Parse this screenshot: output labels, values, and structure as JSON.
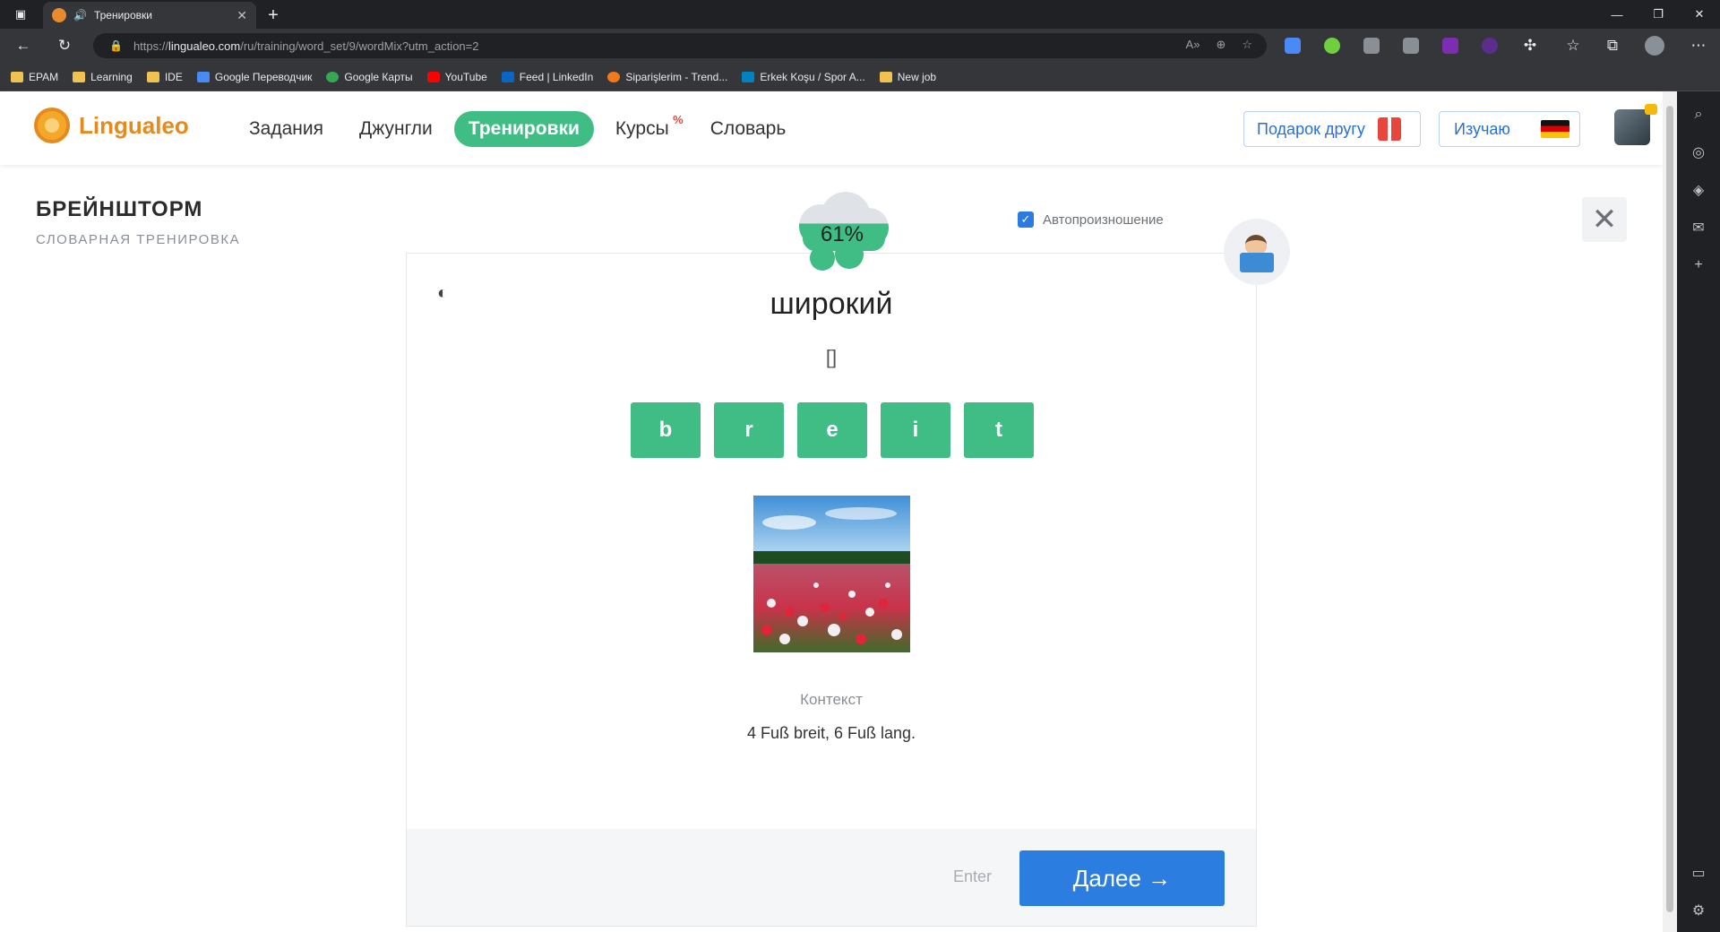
{
  "browser": {
    "tab_title": "Тренировки",
    "url_prefix": "https://",
    "url_host": "lingualeo.com",
    "url_path": "/ru/training/word_set/9/wordMix?utm_action=2",
    "bookmarks": [
      {
        "label": "EPAM",
        "icon": "folder-icon",
        "color": "#f0c24f"
      },
      {
        "label": "Learning",
        "icon": "folder-icon",
        "color": "#f0c24f"
      },
      {
        "label": "IDE",
        "icon": "folder-icon",
        "color": "#f0c24f"
      },
      {
        "label": "Google Переводчик",
        "icon": "google-translate-icon",
        "color": "#4a8af4"
      },
      {
        "label": "Google Карты",
        "icon": "google-maps-icon",
        "color": "#34a853"
      },
      {
        "label": "YouTube",
        "icon": "youtube-icon",
        "color": "#ff0000"
      },
      {
        "label": "Feed | LinkedIn",
        "icon": "linkedin-icon",
        "color": "#0a66c2"
      },
      {
        "label": "Siparişlerim - Trend...",
        "icon": "trendyol-icon",
        "color": "#f27a1a"
      },
      {
        "label": "Erkek Koşu / Spor A...",
        "icon": "decathlon-icon",
        "color": "#0082c3"
      },
      {
        "label": "New job",
        "icon": "folder-icon",
        "color": "#f0c24f"
      }
    ]
  },
  "site": {
    "logo_text": "Lingualeo",
    "menu": [
      {
        "label": "Задания",
        "active": false
      },
      {
        "label": "Джунгли",
        "active": false
      },
      {
        "label": "Тренировки",
        "active": true
      },
      {
        "label": "Курсы",
        "active": false,
        "badge": "%"
      },
      {
        "label": "Словарь",
        "active": false
      }
    ],
    "gift_label": "Подарок другу",
    "learning_label": "Изучаю",
    "accent_color": "#3fbd85",
    "brand_color": "#e58a1f"
  },
  "training": {
    "title": "БРЕЙНШТОРМ",
    "subtitle": "СЛОВАРНАЯ ТРЕНИРОВКА",
    "autospeak_label": "Автопроизношение",
    "autospeak_checked": true,
    "progress_percent_label": "61%",
    "progress": 0.61,
    "word": "широкий",
    "transcription": "[]",
    "letters": [
      "b",
      "r",
      "e",
      "i",
      "t"
    ],
    "context_label": "Контекст",
    "context_text": "4 Fuß breit, 6 Fuß lang.",
    "enter_hint": "Enter",
    "next_label": "Далее →"
  }
}
